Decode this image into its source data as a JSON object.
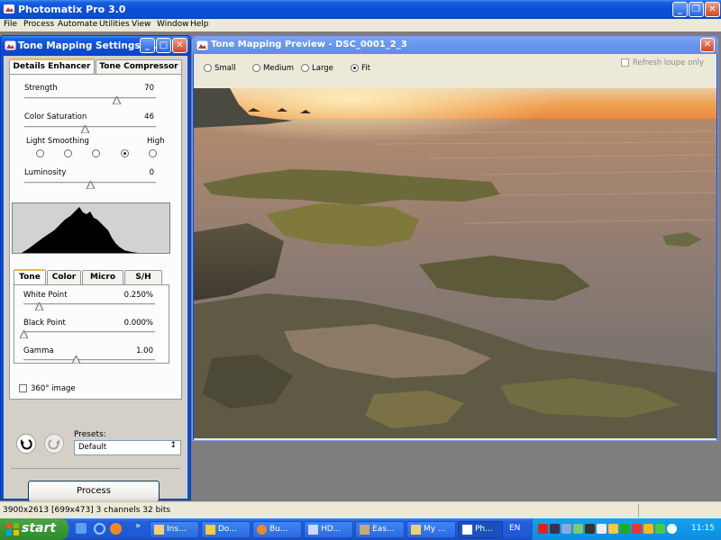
{
  "app": {
    "title": "Photomatix Pro 3.0"
  },
  "menu": [
    "File",
    "Process",
    "Automate",
    "Utilities",
    "View",
    "Window",
    "Help"
  ],
  "settings_panel": {
    "title": "Tone Mapping Settings - ...",
    "tabs": [
      "Details Enhancer",
      "Tone Compressor"
    ],
    "active_tab": "Details Enhancer",
    "strength": {
      "label": "Strength",
      "value": "70",
      "level": 0.7
    },
    "color_saturation": {
      "label": "Color Saturation",
      "value": "46",
      "level": 0.46
    },
    "light_smoothing": {
      "label": "Light Smoothing",
      "high_label": "High",
      "selected_index": 3,
      "count": 5
    },
    "luminosity": {
      "label": "Luminosity",
      "value": "0",
      "level": 0.5
    },
    "subtabs": [
      "Tone",
      "Color",
      "Micro",
      "S/H"
    ],
    "active_subtab": "Tone",
    "white_point": {
      "label": "White Point",
      "value": "0.250%",
      "level": 0.12
    },
    "black_point": {
      "label": "Black Point",
      "value": "0.000%",
      "level": 0.0
    },
    "gamma": {
      "label": "Gamma",
      "value": "1.00",
      "level": 0.4
    },
    "image_360": {
      "label": "360° image",
      "checked": false
    },
    "presets": {
      "label": "Presets:",
      "value": "Default"
    },
    "process_label": "Process"
  },
  "preview": {
    "title": "Tone Mapping Preview - DSC_0001_2_3",
    "sizes": [
      "Small",
      "Medium",
      "Large",
      "Fit"
    ],
    "selected_size": "Fit",
    "refresh_loupe": {
      "label": "Refresh loupe only",
      "checked": false
    }
  },
  "status": {
    "text": "3900x2613 [699x473] 3 channels 32 bits"
  },
  "taskbar": {
    "start_label": "start",
    "chevron": "»",
    "buttons": [
      "Ins...",
      "Do...",
      "Bu...",
      "HD...",
      "Eas...",
      "My ...",
      "Ph..."
    ],
    "active_button": "Ph...",
    "language": "EN",
    "time": "11:15"
  }
}
